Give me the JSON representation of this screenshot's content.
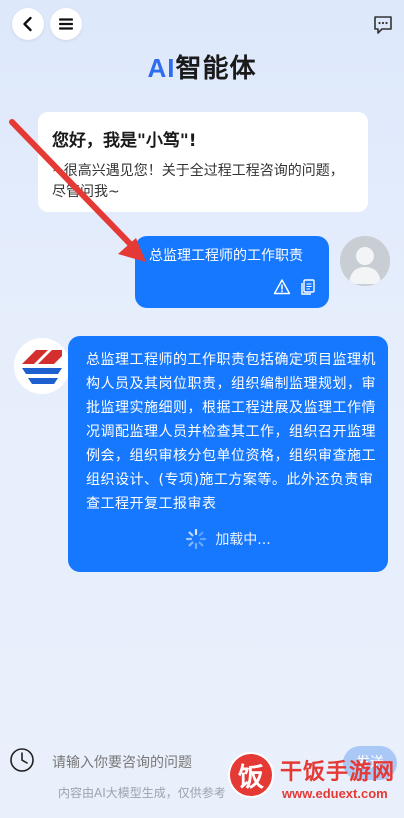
{
  "header": {
    "title_ai": "AI",
    "title_rest": "智能体",
    "icons": [
      "back-arrow-icon",
      "menu-icon",
      "chat-bubble-icon"
    ]
  },
  "welcome": {
    "greeting": "您好，我是\"小笃\"!",
    "text": "~很高兴遇见您！关于全过程工程咨询的问题，尽管问我~"
  },
  "user_message": {
    "text": "总监理工程师的工作职责",
    "tools": [
      "warning-icon",
      "copy-icon"
    ]
  },
  "bot_message": {
    "text": "总监理工程师的工作职责包括确定项目监理机构人员及其岗位职责，组织编制监理规划，审批监理实施细则，根据工程进展及监理工作情况调配监理人员并检查其工作，组织召开监理例会，组织审核分包单位资格，组织审查施工组织设计、(专项)施工方案等。此外还负责审查工程开复工报审表",
    "loading": "加载中..."
  },
  "composer": {
    "placeholder": "请输入你要咨询的问题",
    "send_label": "发送",
    "disclaimer": "内容由AI大模型生成，仅供参考"
  },
  "watermark": {
    "logo_char": "饭",
    "name": "干饭手游网",
    "url": "www.eduext.com"
  },
  "colors": {
    "accent": "#1677ff",
    "title_ai": "#2f6cf0",
    "annotation_arrow": "#e53935"
  }
}
